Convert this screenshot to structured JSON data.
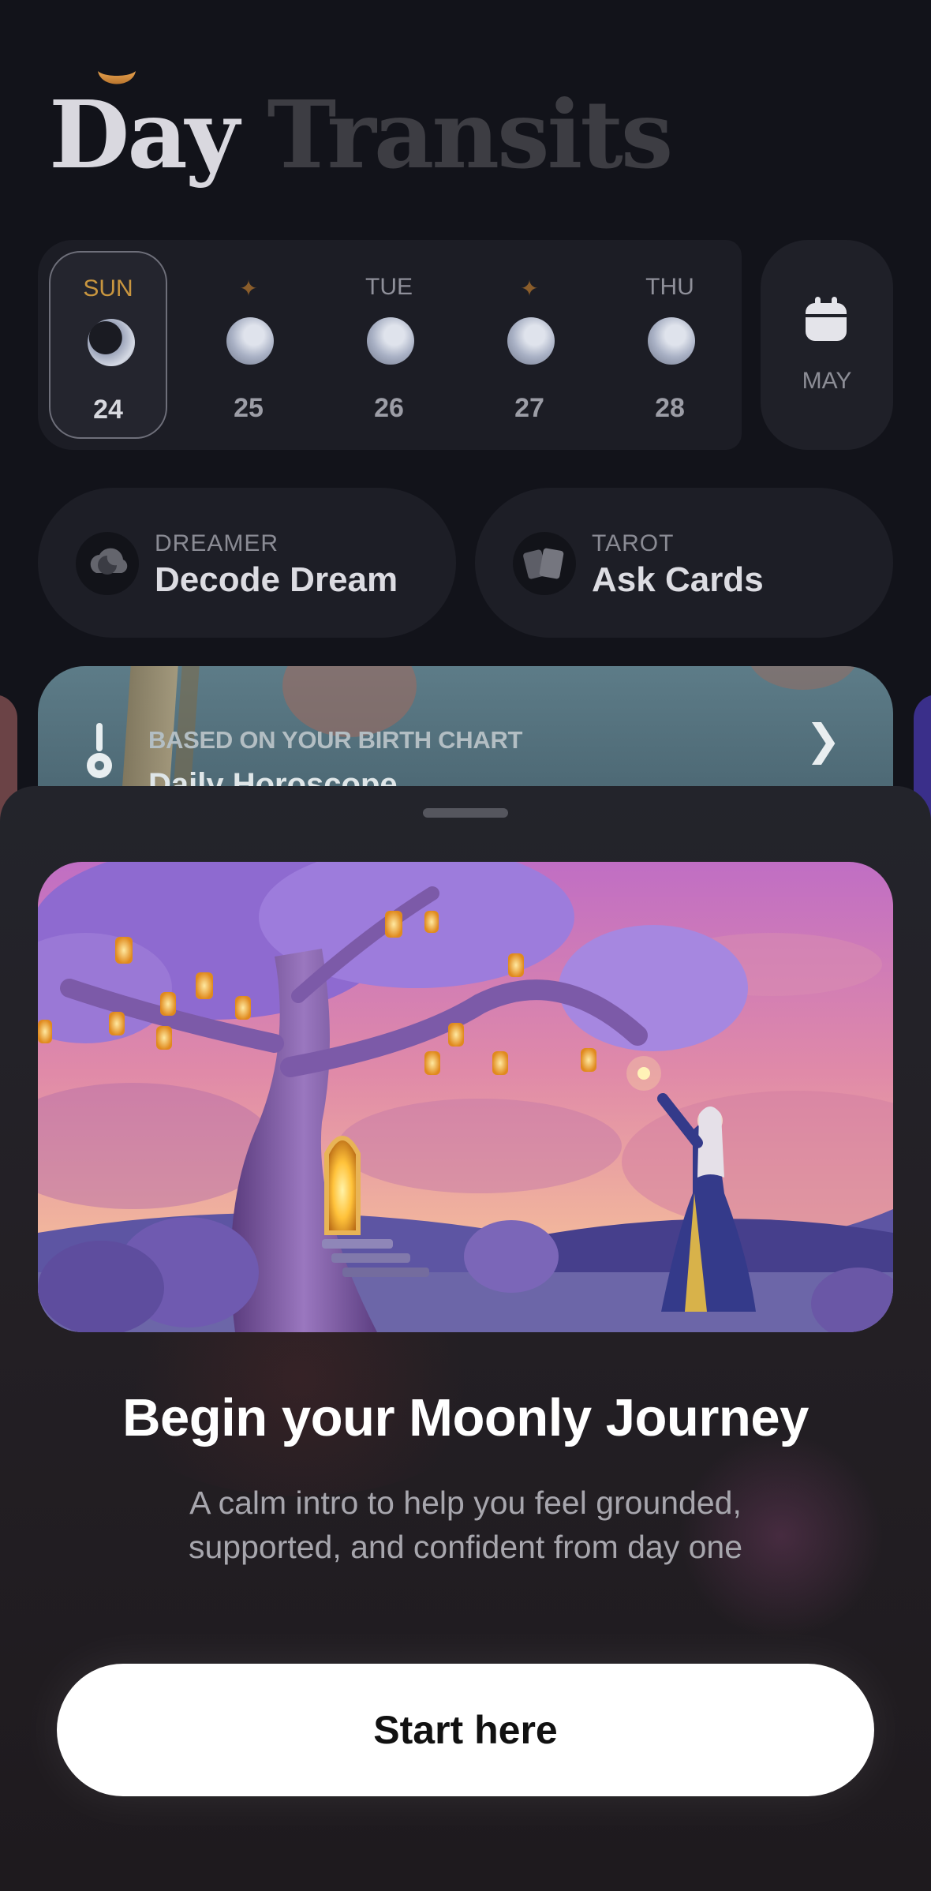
{
  "header": {
    "title_word_1": "Day",
    "title_word_2": "Transits"
  },
  "week": {
    "days": [
      {
        "label": "SUN",
        "marker": "",
        "date": "24",
        "selected": true
      },
      {
        "label": "",
        "marker": "✦",
        "date": "25",
        "selected": false
      },
      {
        "label": "TUE",
        "marker": "",
        "date": "26",
        "selected": false
      },
      {
        "label": "",
        "marker": "✦",
        "date": "27",
        "selected": false
      },
      {
        "label": "THU",
        "marker": "",
        "date": "28",
        "selected": false
      }
    ],
    "month_label": "MAY"
  },
  "shortcuts": {
    "dream": {
      "label": "DREAMER",
      "title": "Decode Dream",
      "icon": "cloud-moon-icon"
    },
    "tarot": {
      "label": "TAROT",
      "title": "Ask Cards",
      "icon": "tarot-cards-icon"
    }
  },
  "horoscope_card": {
    "subtitle": "BASED ON YOUR BIRTH CHART",
    "title": "Daily Horoscope",
    "chevron": "❯"
  },
  "sheet": {
    "heading": "Begin your Moonly Journey",
    "body": "A calm intro to help you feel grounded, supported, and confident from day one",
    "cta_label": "Start here"
  },
  "colors": {
    "accent_gold": "#c9963f",
    "background": "#12131a",
    "cta_bg": "#ffffff"
  }
}
